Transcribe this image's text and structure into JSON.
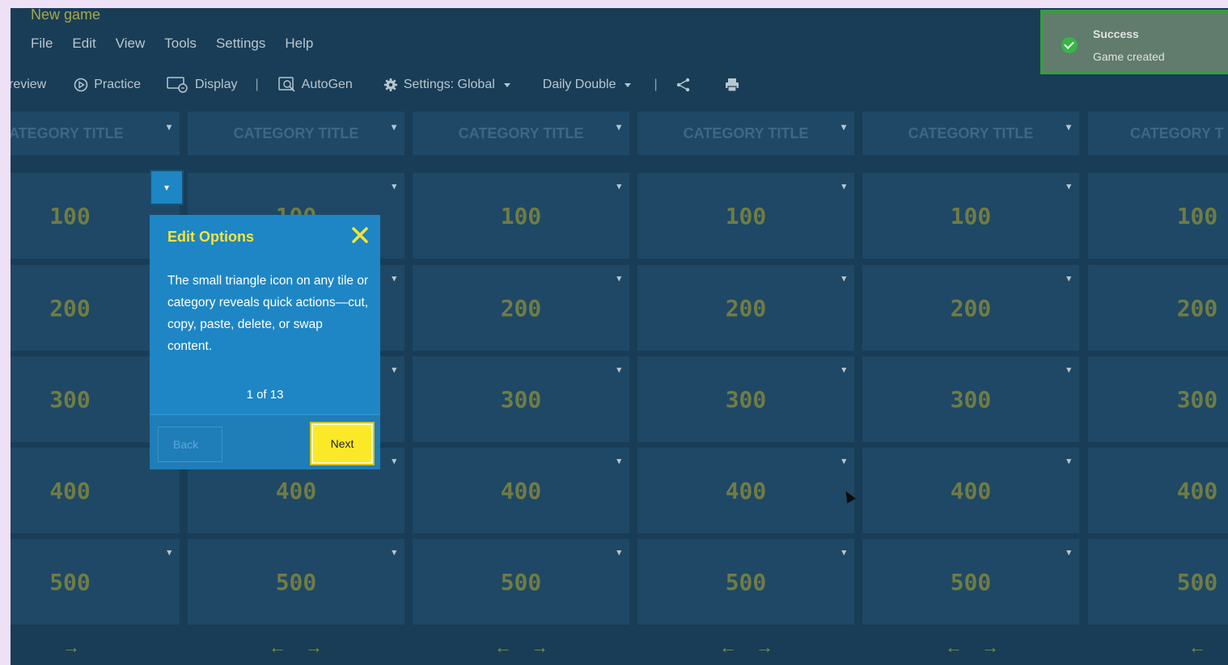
{
  "window": {
    "title": "New game"
  },
  "menu": [
    "File",
    "Edit",
    "View",
    "Tools",
    "Settings",
    "Help"
  ],
  "toolbar": {
    "preview": "review",
    "practice": "Practice",
    "display": "Display",
    "separator": "|",
    "autogen": "AutoGen",
    "settings": "Settings: Global",
    "daily_double": "Daily Double",
    "separator2": "|"
  },
  "toast": {
    "title": "Success",
    "message": "Game created"
  },
  "categories": [
    "CATEGORY TITLE",
    "CATEGORY TITLE",
    "CATEGORY TITLE",
    "CATEGORY TITLE",
    "CATEGORY TITLE",
    "CATEGORY T"
  ],
  "first_category_visible": "ATEGORY TITLE",
  "tile_values": [
    "100",
    "200",
    "300",
    "400",
    "500"
  ],
  "popover": {
    "title": "Edit Options",
    "body": "The small triangle icon on any tile or category reveals quick actions—cut, copy, paste, delete, or swap content.",
    "counter": "1 of 13",
    "back": "Back",
    "next": "Next"
  },
  "caret_glyph": "▾",
  "arrows": {
    "left": "←",
    "right": "→"
  },
  "colors": {
    "background": "#193d56",
    "tile": "#1e4866",
    "accent": "#fbe927",
    "popover": "#1e86c4"
  }
}
